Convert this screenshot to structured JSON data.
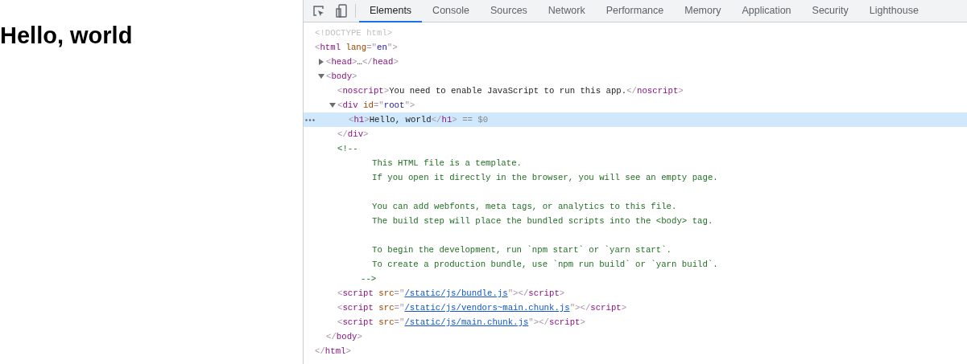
{
  "page": {
    "heading": "Hello, world"
  },
  "devtools": {
    "tabs": [
      {
        "label": "Elements",
        "selected": true
      },
      {
        "label": "Console",
        "selected": false
      },
      {
        "label": "Sources",
        "selected": false
      },
      {
        "label": "Network",
        "selected": false
      },
      {
        "label": "Performance",
        "selected": false
      },
      {
        "label": "Memory",
        "selected": false
      },
      {
        "label": "Application",
        "selected": false
      },
      {
        "label": "Security",
        "selected": false
      },
      {
        "label": "Lighthouse",
        "selected": false
      }
    ],
    "tree": [
      {
        "kind": "doctype",
        "text": "<!DOCTYPE html>",
        "selected": false
      },
      {
        "kind": "element",
        "open": "<html lang=\"en\">",
        "selected": false,
        "close": "</html>",
        "children": [
          {
            "kind": "element",
            "open": "<head>…</head>",
            "expanded": false,
            "selected": false
          },
          {
            "kind": "element",
            "open": "<body>",
            "expanded": true,
            "selected": false,
            "close": "</body>",
            "children": [
              {
                "kind": "element",
                "open": "<noscript>You need to enable JavaScript to run this app.</noscript>",
                "selected": false
              },
              {
                "kind": "element",
                "open": "<div id=\"root\">",
                "expanded": true,
                "selected": false,
                "close": "</div>",
                "children": [
                  {
                    "kind": "element",
                    "open": "<h1>Hello, world</h1>",
                    "suffix": "== $0",
                    "selected": true
                  }
                ]
              },
              {
                "kind": "comment",
                "open": "<!--",
                "selected": false,
                "paragraphs": [
                  [
                    "This HTML file is a template.",
                    "If you open it directly in the browser, you will see an empty page."
                  ],
                  [
                    "You can add webfonts, meta tags, or analytics to this file.",
                    "The build step will place the bundled scripts into the <body> tag."
                  ],
                  [
                    "To begin the development, run `npm start` or `yarn start`.",
                    "To create a production bundle, use `npm run build` or `yarn build`."
                  ]
                ],
                "close": "-->"
              },
              {
                "kind": "element",
                "open": "<script src=\"/static/js/bundle.js\"></script>",
                "links": true,
                "selected": false
              },
              {
                "kind": "element",
                "open": "<script src=\"/static/js/vendors~main.chunk.js\"></script>",
                "links": true,
                "selected": false
              },
              {
                "kind": "element",
                "open": "<script src=\"/static/js/main.chunk.js\"></script>",
                "links": true,
                "selected": false
              }
            ]
          }
        ]
      }
    ]
  }
}
